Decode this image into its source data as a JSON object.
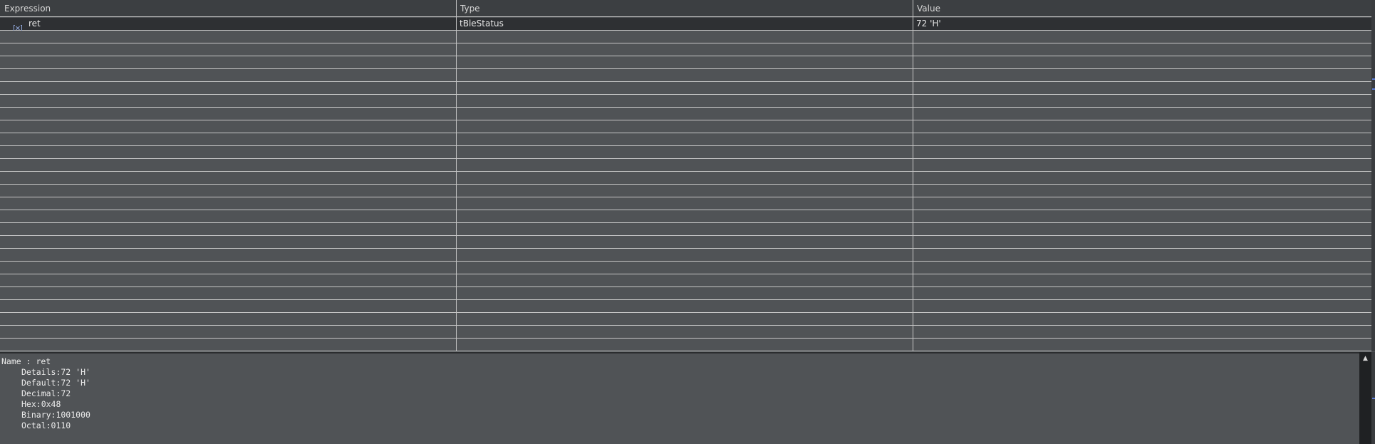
{
  "columns": [
    "Expression",
    "Type",
    "Value"
  ],
  "rows": [
    {
      "expression": "ret",
      "type": "tBleStatus",
      "value": "72 'H'",
      "icon": "variable-icon"
    }
  ],
  "details": {
    "name_line": "Name : ret",
    "lines": [
      "Details:72 'H'",
      "Default:72 'H'",
      "Decimal:72",
      "Hex:0x48",
      "Binary:1001000",
      "Octal:0110"
    ]
  },
  "colors": {
    "background": "#505356",
    "header": "#3c3f42",
    "selected_row": "#2e3033",
    "grid_line": "#c6c6c6",
    "scroll_marker": "#5b7bd3"
  }
}
